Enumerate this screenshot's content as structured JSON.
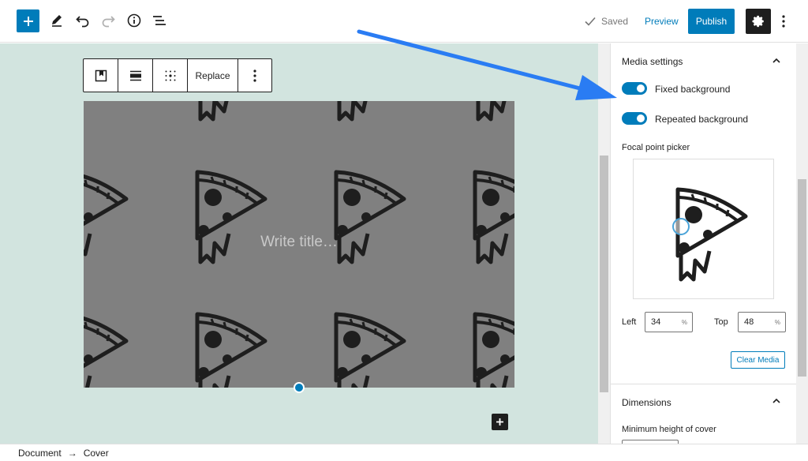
{
  "topbar": {
    "saved_label": "Saved",
    "preview_label": "Preview",
    "publish_label": "Publish"
  },
  "block_toolbar": {
    "replace_label": "Replace"
  },
  "cover": {
    "title_placeholder": "Write title…"
  },
  "sidebar": {
    "media_settings": {
      "title": "Media settings",
      "fixed_background_label": "Fixed background",
      "fixed_background_on": true,
      "repeated_background_label": "Repeated background",
      "repeated_background_on": true,
      "focal_point_label": "Focal point picker",
      "left_label": "Left",
      "left_value": "34",
      "left_unit": "%",
      "top_label": "Top",
      "top_value": "48",
      "top_unit": "%",
      "clear_media_label": "Clear Media"
    },
    "dimensions": {
      "title": "Dimensions",
      "min_height_label": "Minimum height of cover"
    }
  },
  "breadcrumb": {
    "items": [
      "Document",
      "Cover"
    ],
    "separator": "→"
  },
  "colors": {
    "accent": "#007cba",
    "canvas_bg": "#d2e4df",
    "cover_bg": "#808080",
    "annotation_arrow": "#2a7cf3"
  }
}
